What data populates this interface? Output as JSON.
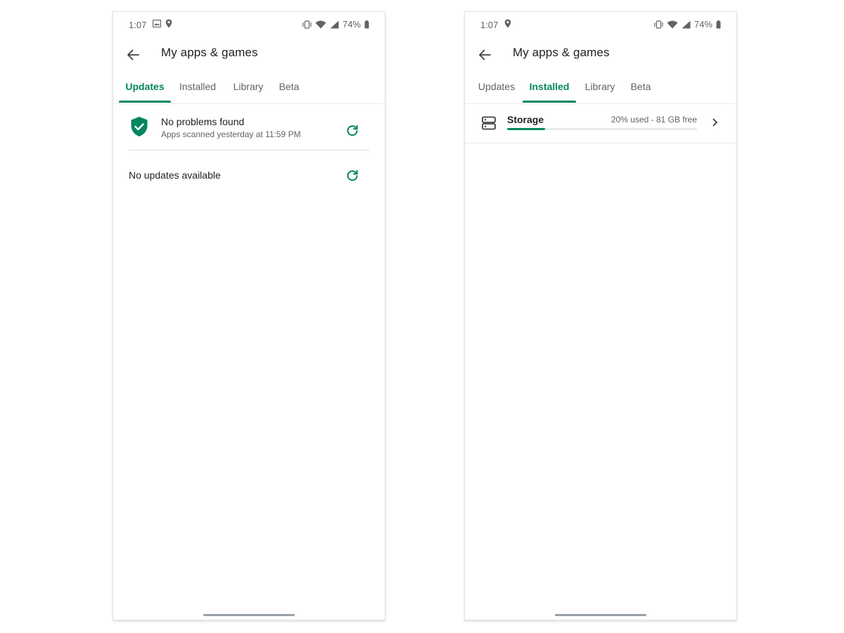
{
  "colors": {
    "accent": "#01875f",
    "text": "#202124",
    "secondary": "#5f6368"
  },
  "screens": [
    {
      "status": {
        "time": "1:07",
        "battery": "74%",
        "icons_left": [
          "gallery-icon",
          "location-icon"
        ],
        "icons_right": [
          "vibrate-icon",
          "wifi-icon",
          "signal-icon",
          "battery-icon"
        ]
      },
      "appbar": {
        "title": "My apps & games"
      },
      "tabs": [
        {
          "label": "Updates",
          "active": true
        },
        {
          "label": "Installed",
          "active": false
        },
        {
          "label": "Library",
          "active": false
        },
        {
          "label": "Beta",
          "active": false
        }
      ],
      "scan": {
        "title": "No problems found",
        "subtitle": "Apps scanned yesterday at 11:59 PM"
      },
      "updates": {
        "text": "No updates available"
      }
    },
    {
      "status": {
        "time": "1:07",
        "battery": "74%",
        "icons_left": [
          "location-icon"
        ],
        "icons_right": [
          "vibrate-icon",
          "wifi-icon",
          "signal-icon",
          "battery-icon"
        ]
      },
      "appbar": {
        "title": "My apps & games"
      },
      "tabs": [
        {
          "label": "Updates",
          "active": false
        },
        {
          "label": "Installed",
          "active": true
        },
        {
          "label": "Library",
          "active": false
        },
        {
          "label": "Beta",
          "active": false
        }
      ],
      "storage": {
        "label": "Storage",
        "detail": "20% used - 81 GB free",
        "used_fraction": 0.2
      }
    }
  ]
}
